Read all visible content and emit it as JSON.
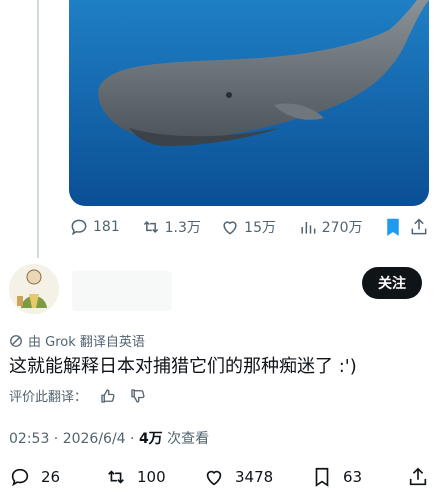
{
  "parent_post": {
    "media_alt": "sperm whale",
    "actions": {
      "replies": "181",
      "reposts": "1.3万",
      "likes": "15万",
      "views": "270万"
    },
    "bookmark_color": "#1d9bf0"
  },
  "reply": {
    "follow_label": "关注",
    "translation_note": "由 Grok 翻译自英语",
    "text": "这就能解释日本对捕猎它们的那种痴迷了 :')",
    "rate_translation_label": "评价此翻译：",
    "timestamp": "02:53 · 2026/6/4 · ",
    "views_count": "4万",
    "views_label": " 次查看",
    "actions": {
      "replies": "26",
      "reposts": "100",
      "likes": "3478",
      "bookmarks": "63"
    }
  },
  "icons": [
    "reply-icon",
    "repost-icon",
    "like-icon",
    "views-icon",
    "bookmark-icon",
    "share-icon",
    "thumbs-up-icon",
    "thumbs-down-icon",
    "grok-icon"
  ]
}
